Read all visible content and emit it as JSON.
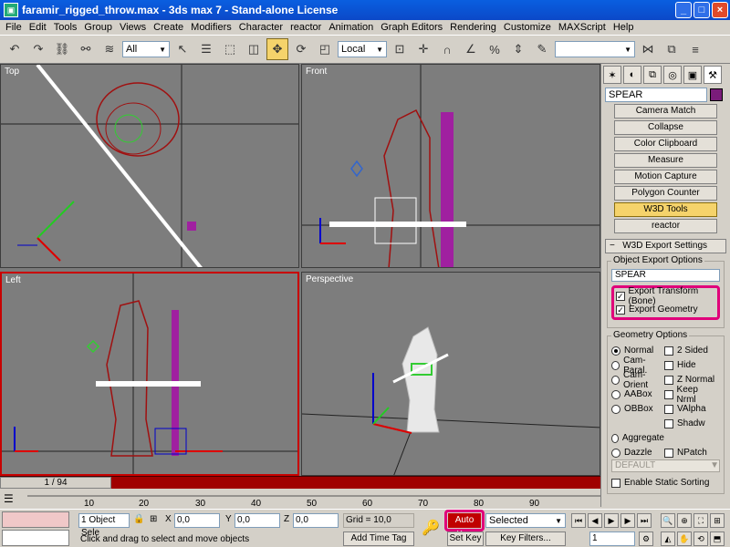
{
  "window": {
    "title": "faramir_rigged_throw.max - 3ds max 7 - Stand-alone License"
  },
  "menu": [
    "File",
    "Edit",
    "Tools",
    "Group",
    "Views",
    "Create",
    "Modifiers",
    "Character",
    "reactor",
    "Animation",
    "Graph Editors",
    "Rendering",
    "Customize",
    "MAXScript",
    "Help"
  ],
  "toolbar": {
    "filter_select": "All",
    "ref_coord": "Local",
    "named_sel": ""
  },
  "viewports": {
    "top": "Top",
    "front": "Front",
    "left": "Left",
    "perspective": "Perspective"
  },
  "command_panel": {
    "object_name": "SPEAR",
    "object_color": "#7a1c7a",
    "utilities": [
      "Camera Match",
      "Collapse",
      "Color Clipboard",
      "Measure",
      "Motion Capture",
      "Polygon Counter",
      "W3D Tools",
      "reactor"
    ],
    "active_utility": "W3D Tools",
    "rollout_title": "W3D Export Settings",
    "rollout_toggle": "−",
    "object_export_options": {
      "title": "Object Export Options",
      "name": "SPEAR",
      "export_transform": "Export Transform (Bone)",
      "export_geometry": "Export Geometry"
    },
    "geometry_options": {
      "title": "Geometry Options",
      "left": [
        "Normal",
        "Cam-Paral.",
        "Cam-Orient",
        "AABox",
        "OBBox"
      ],
      "right": [
        "2 Sided",
        "Hide",
        "Z Normal",
        "Keep Nrml",
        "VAlpha",
        "Shadw"
      ],
      "aggregate": "Aggregate",
      "dazzle": "Dazzle",
      "npatch": "NPatch",
      "dazzle_type": "DEFAULT",
      "static_sorting": "Enable Static Sorting"
    }
  },
  "timeline": {
    "frame_label": "1 / 94",
    "ticks": [
      "10",
      "20",
      "30",
      "40",
      "50",
      "60",
      "70",
      "80",
      "90"
    ]
  },
  "status": {
    "selection": "1 Object Sele",
    "x_label": "X",
    "x_value": "0,0",
    "y_label": "Y",
    "y_value": "0,0",
    "z_label": "Z",
    "z_value": "0,0",
    "grid": "Grid = 10,0",
    "prompt": "Click and drag to select and move objects",
    "add_time_tag": "Add Time Tag",
    "auto_key": "Auto Key",
    "set_key": "Set Key",
    "key_mode": "Selected",
    "key_filters": "Key Filters...",
    "current_frame": "1"
  }
}
